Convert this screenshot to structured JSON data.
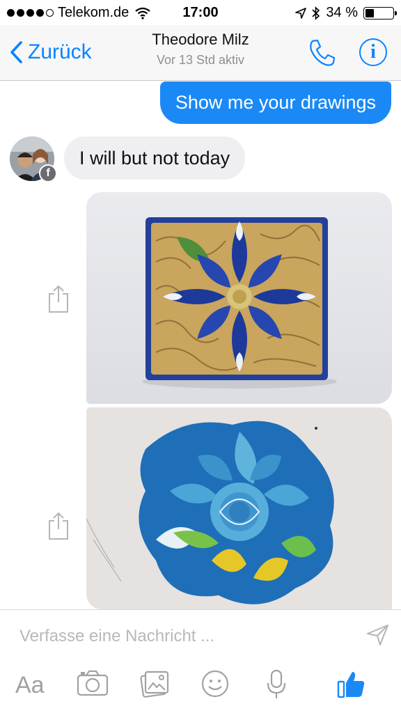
{
  "status": {
    "carrier": "Telekom.de",
    "time": "17:00",
    "battery": "34 %",
    "battery_level": 0.34
  },
  "header": {
    "back_label": "Zurück",
    "name": "Theodore Milz",
    "subtitle": "Vor 13 Std aktiv"
  },
  "messages": {
    "outgoing_text": "Show me your drawings",
    "incoming_text": "I will but not today"
  },
  "composer": {
    "placeholder": "Verfasse eine Nachricht ...",
    "aa_label": "Aa"
  },
  "colors": {
    "accent": "#0a84ff",
    "bubble_out": "#1b89f5",
    "bubble_in": "#efeff2",
    "like_blue": "#1b89f5"
  },
  "icons": {
    "share": "share-icon",
    "camera": "camera-icon",
    "gallery": "gallery-icon",
    "emoji": "emoji-icon",
    "mic": "microphone-icon",
    "like": "thumbs-up-icon",
    "send": "send-icon",
    "phone": "phone-icon",
    "info": "info-icon"
  }
}
